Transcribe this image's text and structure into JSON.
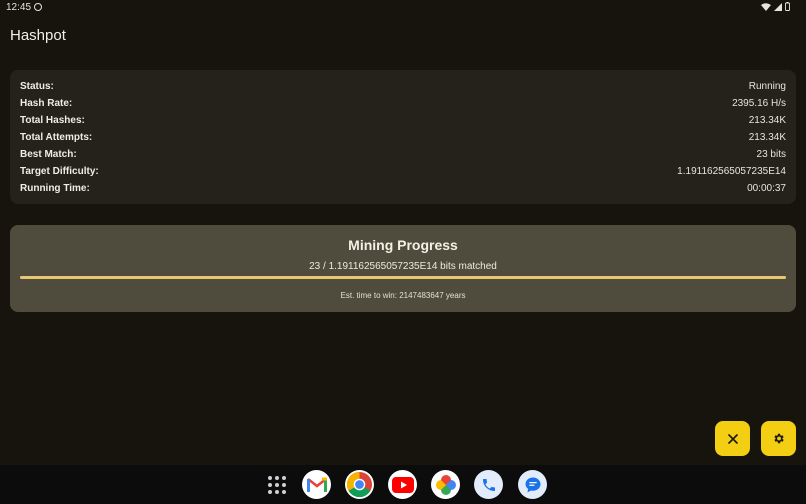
{
  "status_bar": {
    "time": "12:45"
  },
  "app": {
    "title": "Hashpot"
  },
  "stats": [
    {
      "label": "Status:",
      "value": "Running"
    },
    {
      "label": "Hash Rate:",
      "value": "2395.16 H/s"
    },
    {
      "label": "Total Hashes:",
      "value": "213.34K"
    },
    {
      "label": "Total Attempts:",
      "value": "213.34K"
    },
    {
      "label": "Best Match:",
      "value": "23 bits"
    },
    {
      "label": "Target Difficulty:",
      "value": "1.191162565057235E14"
    },
    {
      "label": "Running Time:",
      "value": "00:00:37"
    }
  ],
  "progress": {
    "title": "Mining Progress",
    "matched_text": "23 / 1.191162565057235E14 bits matched",
    "fraction": 1.0,
    "estimate_text": "Est. time to win: 2147483647 years"
  },
  "fabs": {
    "stop_icon": "close-icon",
    "settings_icon": "gear-icon"
  },
  "dock": {
    "items": [
      "app-drawer",
      "gmail",
      "chrome",
      "youtube",
      "photos",
      "phone",
      "messages"
    ]
  },
  "colors": {
    "background": "#16140d",
    "card": "#24221a",
    "progress_card": "#4f4b3d",
    "progress_fill": "#e8c774",
    "fab": "#f4ce12"
  }
}
